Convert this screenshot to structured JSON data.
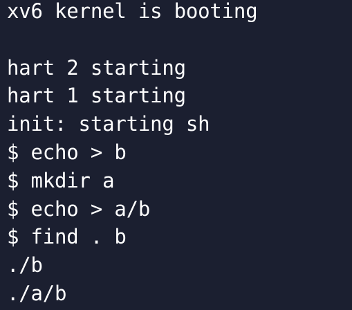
{
  "terminal": {
    "lines": [
      "xv6 kernel is booting",
      "",
      "hart 2 starting",
      "hart 1 starting",
      "init: starting sh",
      "$ echo > b",
      "$ mkdir a",
      "$ echo > a/b",
      "$ find . b",
      "./b",
      "./a/b"
    ],
    "background_color": "#1b1f30",
    "text_color": "#ffffff"
  }
}
